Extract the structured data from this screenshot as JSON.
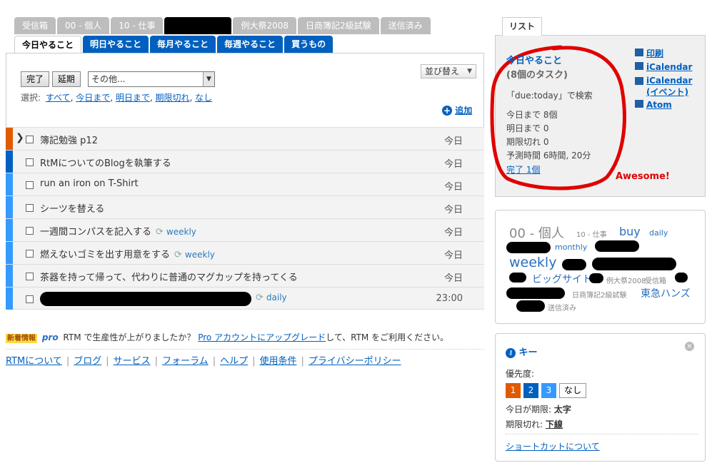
{
  "list_tabs": [
    "受信箱",
    "00 - 個人",
    "10 - 仕事",
    "",
    "例大祭2008",
    "日商簿記2級試験",
    "送信済み"
  ],
  "sub_tabs": [
    "今日やること",
    "明日やること",
    "毎月やること",
    "毎週やること",
    "買うもの"
  ],
  "toolbar": {
    "complete": "完了",
    "postpone": "延期",
    "more": "その他...",
    "sort": "並び替え",
    "select_label": "選択:",
    "select_links": [
      "すべて",
      "今日まで",
      "明日まで",
      "期限切れ",
      "なし"
    ],
    "add": "追加"
  },
  "tasks": [
    {
      "name": "簿記勉強 p12",
      "date": "今日",
      "rep": "",
      "color": "#e05a00"
    },
    {
      "name": "RtMについてのBlogを執筆する",
      "date": "今日",
      "rep": "",
      "color": "#0060bf"
    },
    {
      "name": "run an iron on T-Shirt",
      "date": "今日",
      "rep": "",
      "color": "#359aff"
    },
    {
      "name": "シーツを替える",
      "date": "今日",
      "rep": "",
      "color": "#359aff"
    },
    {
      "name": "一週間コンパスを記入する",
      "date": "今日",
      "rep": "weekly",
      "color": "#359aff"
    },
    {
      "name": "燃えないゴミを出す用意をする",
      "date": "今日",
      "rep": "weekly",
      "color": "#359aff"
    },
    {
      "name": "茶器を持って帰って、代わりに普通のマグカップを持ってくる",
      "date": "今日",
      "rep": "",
      "color": "#359aff"
    },
    {
      "name": "",
      "date": "23:00",
      "rep": "daily",
      "color": "#359aff"
    }
  ],
  "promo": {
    "badge": "新着情報",
    "pro": "pro",
    "text1": "RTM で生産性が上がりましたか？",
    "link": "Pro アカウントにアップグレード",
    "text2": "して、RTM をご利用ください。"
  },
  "footer_links": [
    "RTMについて",
    "ブログ",
    "サービス",
    "フォーラム",
    "ヘルプ",
    "使用条件",
    "プライバシーポリシー"
  ],
  "list_box": {
    "tab": "リスト",
    "title": "今日やること",
    "count": "(8個のタスク)",
    "search": "「due:today」で検索",
    "stats": [
      "今日まで 8個",
      "明日まで 0",
      "期限切れ 0",
      "予測時間 6時間, 20分"
    ],
    "completed": "完了 1個",
    "links": [
      "印刷",
      "iCalendar",
      "iCalendar (イベント)",
      "Atom"
    ],
    "annotation": "Awesome!"
  },
  "tag_cloud": {
    "t1": "00 - 個人",
    "t2": "10 - 仕事",
    "t3": "buy",
    "t4": "daily",
    "t5": "monthly",
    "t6": "weekly",
    "t7": "ビッグサイト",
    "t8": "例大祭2008",
    "t9": "受信箱",
    "t10": "日商簿記2級試験",
    "t11": "東急ハンズ",
    "t12": "送信済み"
  },
  "key_box": {
    "title": "キー",
    "priority_label": "優先度:",
    "priorities": [
      "1",
      "2",
      "3",
      "なし"
    ],
    "due_today": "今日が期限:",
    "due_today_style": "太字",
    "overdue": "期限切れ:",
    "overdue_style": "下線",
    "shortcuts": "ショートカットについて"
  }
}
